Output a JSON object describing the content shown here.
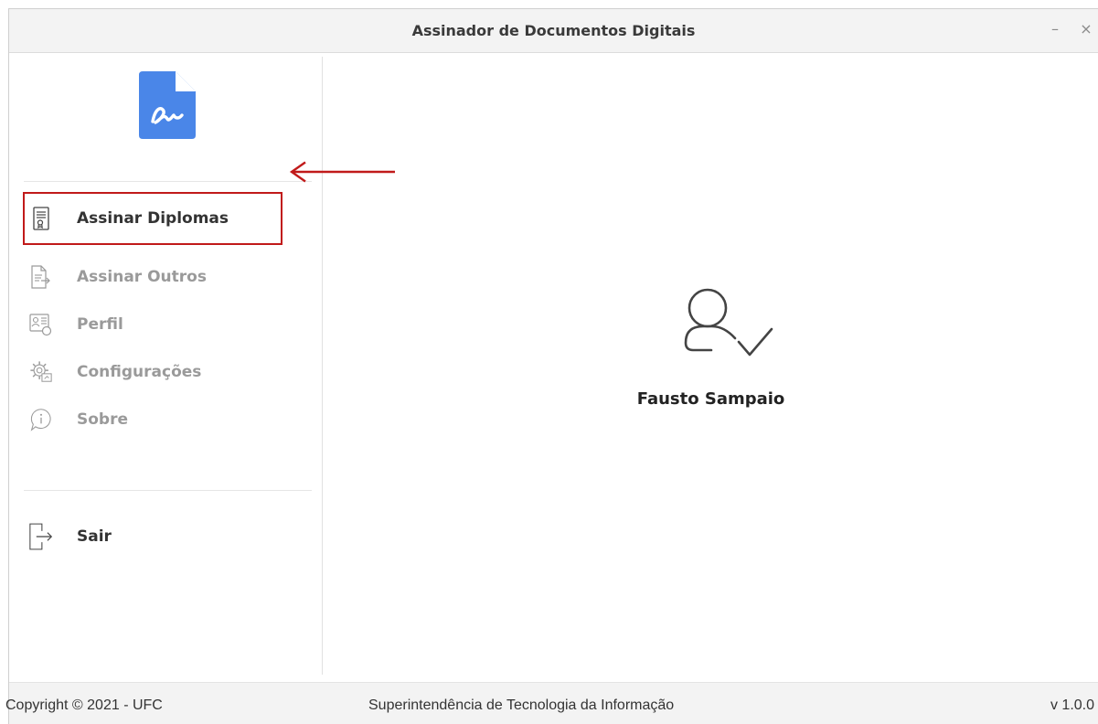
{
  "window": {
    "title": "Assinador de Documentos Digitais",
    "controls": {
      "minimize": "–",
      "close": "×"
    }
  },
  "logo": {
    "icon": "document-signature-icon",
    "color": "#4a86e8"
  },
  "nav": {
    "items": [
      {
        "label": "Assinar Diplomas",
        "icon": "diploma-icon",
        "state": "active"
      },
      {
        "label": "Assinar Outros",
        "icon": "document-export-icon",
        "state": "disabled"
      },
      {
        "label": "Perfil",
        "icon": "profile-card-icon",
        "state": "disabled"
      },
      {
        "label": "Configurações",
        "icon": "gear-icon",
        "state": "disabled"
      },
      {
        "label": "Sobre",
        "icon": "info-bubble-icon",
        "state": "disabled"
      }
    ],
    "logout": {
      "label": "Sair",
      "icon": "logout-icon"
    }
  },
  "annotation": {
    "color": "#c11a1a",
    "target": "Assinar Diplomas"
  },
  "user": {
    "name": "Fausto Sampaio",
    "icon": "user-check-icon"
  },
  "footer": {
    "copyright": "Copyright © 2021 - UFC",
    "org": "Superintendência de Tecnologia da Informação",
    "version": "v 1.0.0"
  }
}
